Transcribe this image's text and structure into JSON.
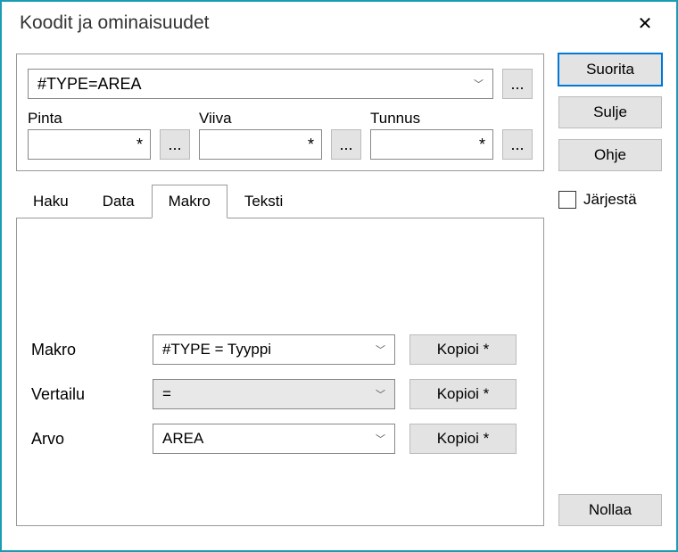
{
  "window": {
    "title": "Koodit ja ominaisuudet"
  },
  "search": {
    "type_combo_value": "#TYPE=AREA",
    "fields": {
      "pinta": {
        "label": "Pinta",
        "value": "*"
      },
      "viiva": {
        "label": "Viiva",
        "value": "*"
      },
      "tunnus": {
        "label": "Tunnus",
        "value": "*"
      }
    }
  },
  "tabs": {
    "haku": "Haku",
    "data": "Data",
    "makro": "Makro",
    "teksti": "Teksti",
    "active": "makro"
  },
  "makro_panel": {
    "makro_label": "Makro",
    "makro_value": "#TYPE = Tyyppi",
    "vertailu_label": "Vertailu",
    "vertailu_value": "=",
    "arvo_label": "Arvo",
    "arvo_value": "AREA",
    "kopioi_label": "Kopioi *"
  },
  "actions": {
    "suorita": "Suorita",
    "sulje": "Sulje",
    "ohje": "Ohje",
    "jarjesta": "Järjestä",
    "nollaa": "Nollaa"
  },
  "ellipsis": "..."
}
